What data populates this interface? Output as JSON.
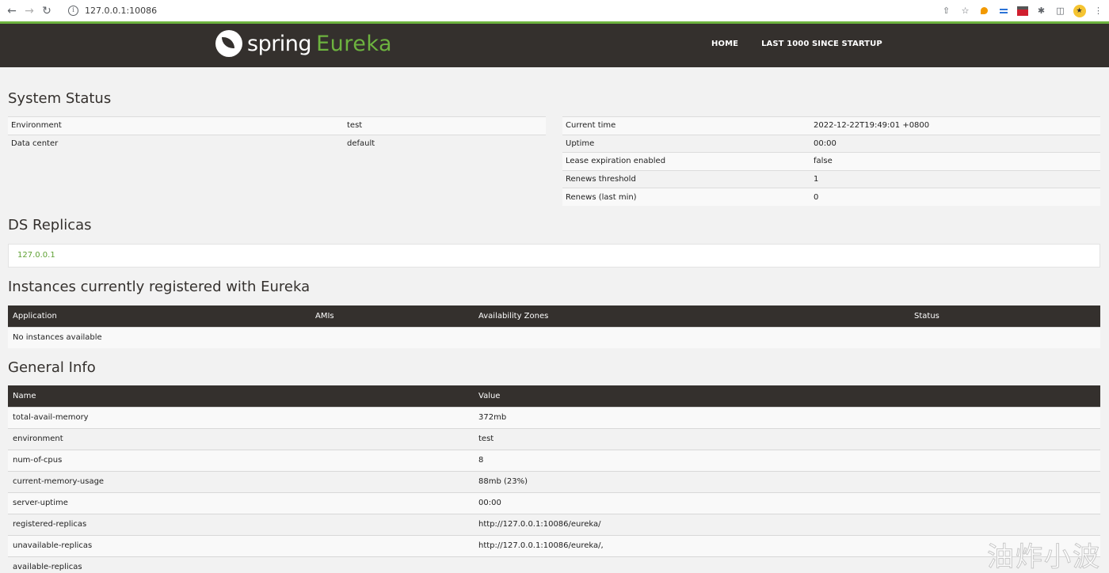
{
  "browser": {
    "url": "127.0.0.1:10086",
    "icons": [
      "back-icon",
      "forward-icon",
      "reload-icon",
      "info-icon",
      "share-icon",
      "star-icon",
      "extensions-icon",
      "sidebar-icon",
      "menu-icon"
    ]
  },
  "header": {
    "logo_spring": "spring",
    "logo_eureka": "Eureka",
    "nav": [
      "HOME",
      "LAST 1000 SINCE STARTUP"
    ],
    "colors": {
      "bar": "#34302d",
      "accent": "#6db33f"
    }
  },
  "system_status": {
    "title": "System Status",
    "left": [
      {
        "key": "Environment",
        "value": "test"
      },
      {
        "key": "Data center",
        "value": "default"
      }
    ],
    "right": [
      {
        "key": "Current time",
        "value": "2022-12-22T19:49:01 +0800"
      },
      {
        "key": "Uptime",
        "value": "00:00"
      },
      {
        "key": "Lease expiration enabled",
        "value": "false"
      },
      {
        "key": "Renews threshold",
        "value": "1"
      },
      {
        "key": "Renews (last min)",
        "value": "0"
      }
    ]
  },
  "ds_replicas": {
    "title": "DS Replicas",
    "items": [
      "127.0.0.1"
    ]
  },
  "instances": {
    "title": "Instances currently registered with Eureka",
    "columns": [
      "Application",
      "AMIs",
      "Availability Zones",
      "Status"
    ],
    "empty_text": "No instances available"
  },
  "general_info": {
    "title": "General Info",
    "columns": [
      "Name",
      "Value"
    ],
    "rows": [
      {
        "name": "total-avail-memory",
        "value": "372mb"
      },
      {
        "name": "environment",
        "value": "test"
      },
      {
        "name": "num-of-cpus",
        "value": "8"
      },
      {
        "name": "current-memory-usage",
        "value": "88mb (23%)"
      },
      {
        "name": "server-uptime",
        "value": "00:00"
      },
      {
        "name": "registered-replicas",
        "value": "http://127.0.0.1:10086/eureka/"
      },
      {
        "name": "unavailable-replicas",
        "value": "http://127.0.0.1:10086/eureka/,"
      },
      {
        "name": "available-replicas",
        "value": ""
      }
    ]
  },
  "watermark": "油炸小波"
}
